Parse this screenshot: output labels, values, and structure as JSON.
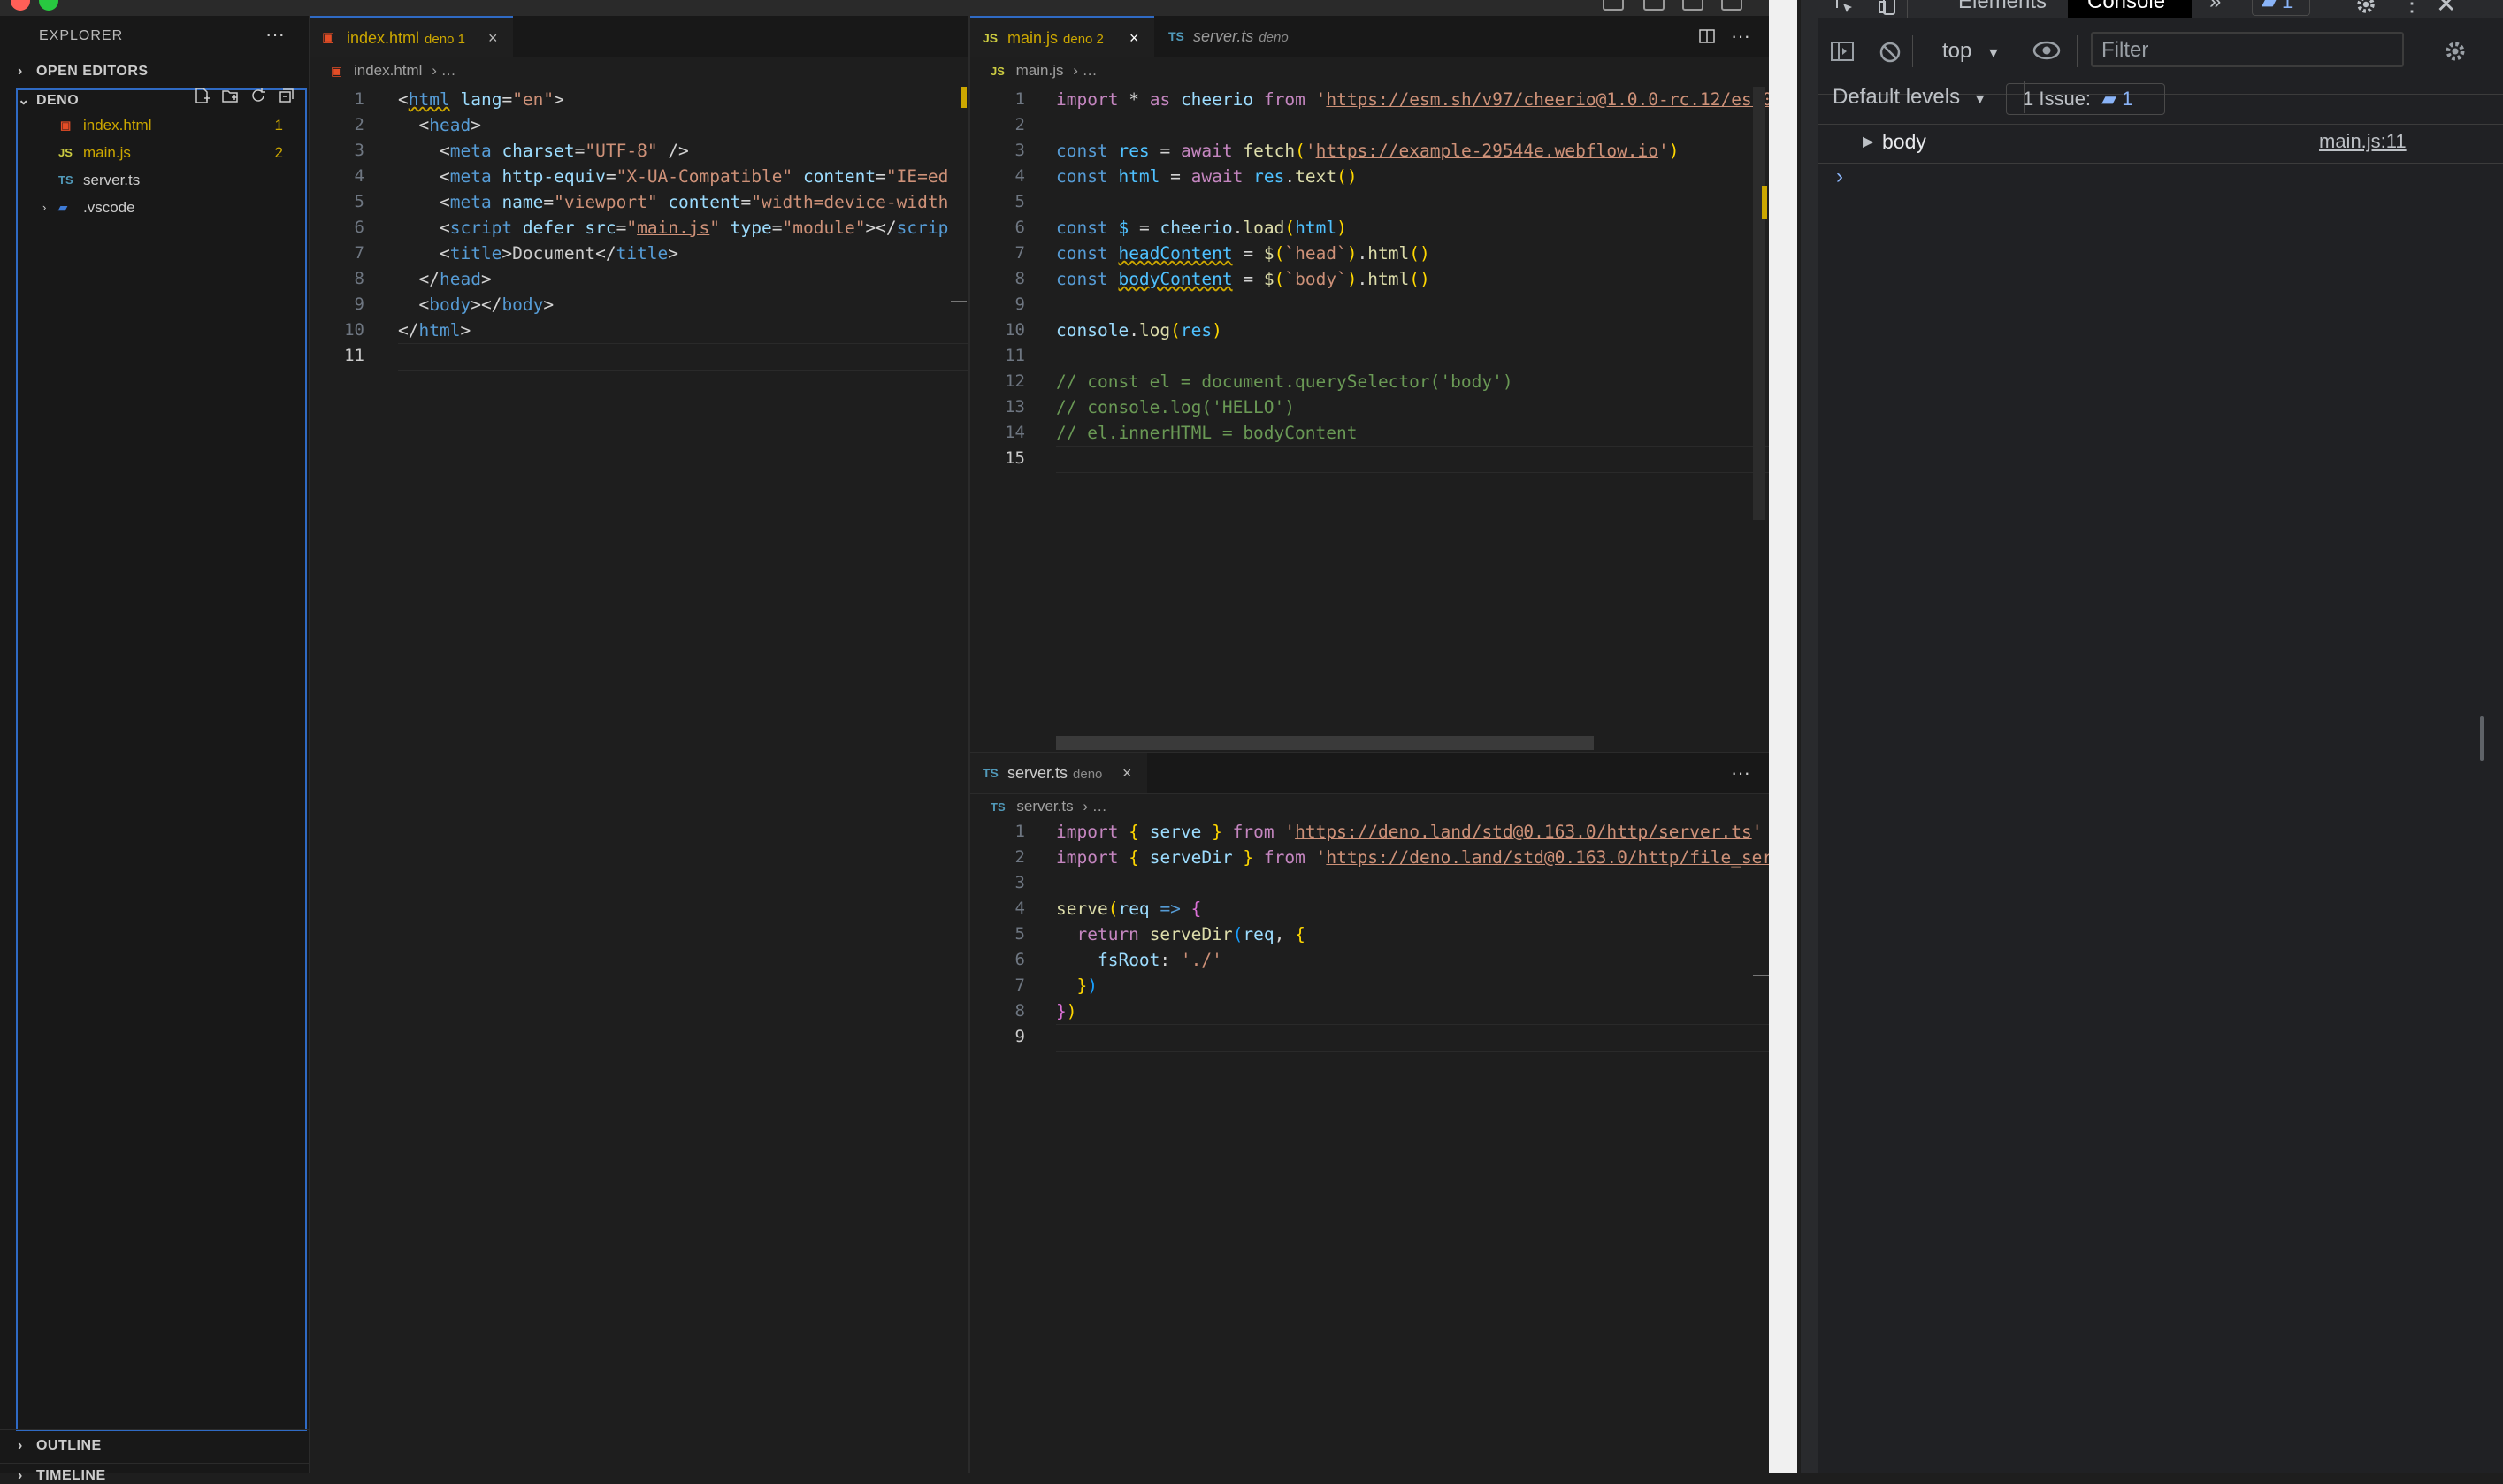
{
  "explorer": {
    "title": "EXPLORER",
    "more": "···",
    "open_editors": "OPEN EDITORS",
    "project": "DENO",
    "files": [
      {
        "icon": "html",
        "name": "index.html",
        "badge": "1"
      },
      {
        "icon": "JS",
        "name": "main.js",
        "badge": "2"
      },
      {
        "icon": "TS",
        "name": "server.ts",
        "badge": ""
      },
      {
        "icon": "folder",
        "name": ".vscode",
        "badge": ""
      }
    ],
    "outline": "OUTLINE",
    "timeline": "TIMELINE"
  },
  "left_group": {
    "tab_name": "index.html",
    "tab_sub": "deno 1",
    "more": "···",
    "breadcrumb_file": "index.html",
    "breadcrumb_rest": "…"
  },
  "right_top_group": {
    "tab1_icon": "JS",
    "tab1_name": "main.js",
    "tab1_sub": "deno 2",
    "tab2_icon": "TS",
    "tab2_name": "server.ts",
    "tab2_sub": "deno",
    "more": "···",
    "breadcrumb_icon": "JS",
    "breadcrumb_file": "main.js",
    "breadcrumb_rest": "…"
  },
  "right_bottom_group": {
    "tab_icon": "TS",
    "tab_name": "server.ts",
    "tab_sub": "deno",
    "more": "···",
    "breadcrumb_icon": "TS",
    "breadcrumb_file": "server.ts",
    "breadcrumb_rest": "…"
  },
  "devtools": {
    "tab_elements": "Elements",
    "tab_console": "Console",
    "issues_count": "1",
    "context": "top",
    "filter_placeholder": "Filter",
    "levels": "Default levels",
    "issue_label": "1 Issue:",
    "issue_count": "1",
    "log_entry": "body",
    "log_source": "main.js:11"
  },
  "colors": {
    "accent": "#2f6ac4",
    "warning": "#cca700",
    "console_tab_bg": "#000000"
  }
}
